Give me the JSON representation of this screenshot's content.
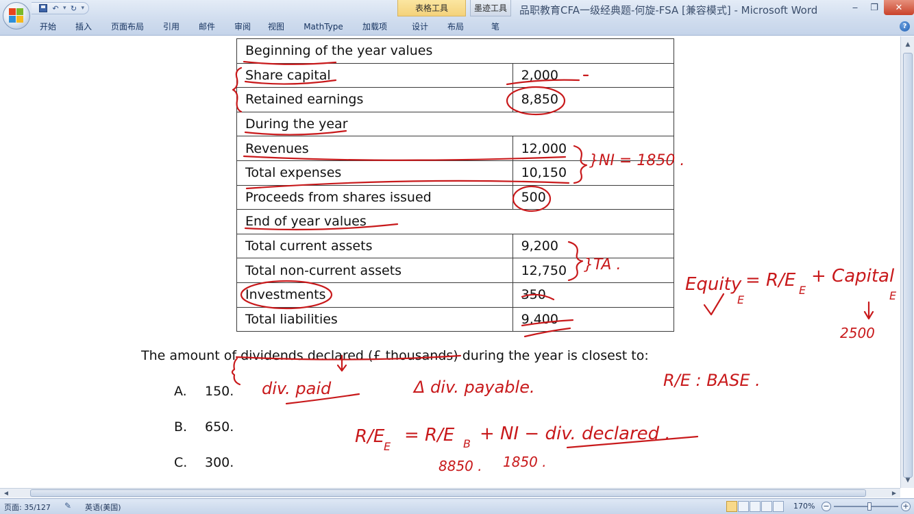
{
  "window": {
    "title": "品职教育CFA一级经典题-何旋-FSA [兼容模式] - Microsoft Word",
    "context_tab_table": "表格工具",
    "context_tab_ink": "墨迹工具",
    "minimize": "‒",
    "restore": "❐",
    "close": "✕"
  },
  "qat": {
    "undo": "↶",
    "redo": "↻",
    "more": "▾"
  },
  "ribbon_tabs": [
    "开始",
    "插入",
    "页面布局",
    "引用",
    "邮件",
    "审阅",
    "视图",
    "MathType",
    "加载项",
    "设计",
    "布局",
    "笔"
  ],
  "help": "?",
  "table": {
    "rows": [
      {
        "label": "Beginning of the year values",
        "value": "",
        "header": true
      },
      {
        "label": "Share capital",
        "value": "2,000"
      },
      {
        "label": "Retained earnings",
        "value": "8,850"
      },
      {
        "label": "During the year",
        "value": "",
        "header": true
      },
      {
        "label": "Revenues",
        "value": "12,000"
      },
      {
        "label": "Total expenses",
        "value": "10,150"
      },
      {
        "label": "Proceeds from shares issued",
        "value": "500"
      },
      {
        "label": "End of year values",
        "value": "",
        "header": true
      },
      {
        "label": "Total current assets",
        "value": "9,200"
      },
      {
        "label": "Total non-current assets",
        "value": "12,750"
      },
      {
        "label": "Investments",
        "value": "350"
      },
      {
        "label": "Total liabilities",
        "value": "9,400"
      }
    ]
  },
  "question": "The amount of dividends declared (£ thousands) during the year is closest to:",
  "options": [
    {
      "letter": "A.",
      "text": "150."
    },
    {
      "letter": "B.",
      "text": "650."
    },
    {
      "letter": "C.",
      "text": "300."
    }
  ],
  "ink_notes": {
    "ni_eq": "}NI = 1850 .",
    "ta": "}TA .",
    "equity_formula": "Equity",
    "equity_sub": "E",
    "equity_rhs": "= R/E",
    "equity_rhs_sub": "E",
    "capital": "+ Capital",
    "capital_sub": "E",
    "capital_val": "2500",
    "div_paid": "div. paid",
    "delta_div_payable": "Δ div. payable.",
    "re_base": "R/E : BASE .",
    "re_formula_lhs": "R/E",
    "re_formula_lhs_sub": "E",
    "re_formula_mid": "= R/E",
    "re_formula_mid_sub": "B",
    "re_formula_rhs": "+ NI − div. declared .",
    "val_8850": "8850 .",
    "val_1850": "1850 ."
  },
  "status": {
    "page": "页面: 35/127",
    "language": "英语(美国)",
    "zoom": "170%",
    "zoom_minus": "−",
    "zoom_plus": "+"
  },
  "colors": {
    "ink": "#c8191b",
    "ribbon": "#cfdcee",
    "context_table": "#f4d27b"
  }
}
